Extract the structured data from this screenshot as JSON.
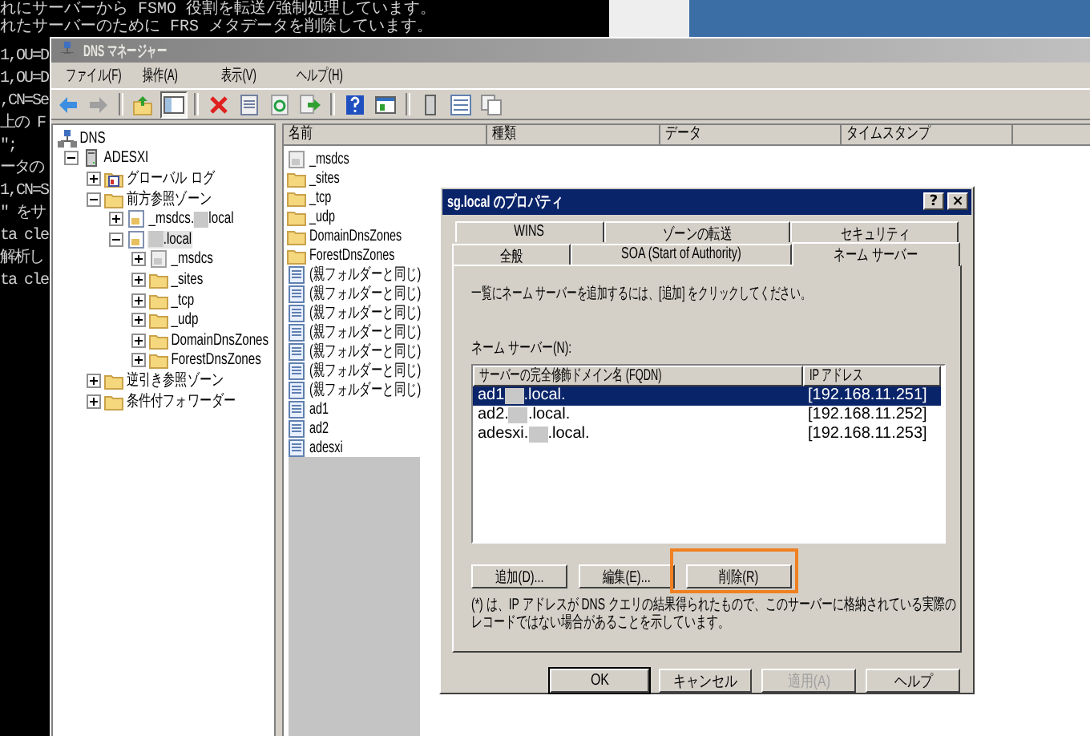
{
  "console": {
    "top_lines": [
      "れにサーバーから FSMO 役割を転送/強制処理しています。",
      "れたサーバーのために FRS メタデータを削除しています。"
    ],
    "side_lines": [
      "1,OU=D",
      "1,OU=D",
      ",CN=Se",
      "上の F",
      "\";",
      "ータの",
      "1,CN=S",
      "\" をサ",
      "ta cle",
      "解析し",
      "ta cle"
    ]
  },
  "window": {
    "title": "DNS マネージャー"
  },
  "menu": [
    "ファイル(F)",
    "操作(A)",
    "表示(V)",
    "ヘルプ(H)"
  ],
  "toolbar": [
    {
      "kind": "back",
      "pressed": false
    },
    {
      "kind": "forward",
      "pressed": false
    },
    {
      "kind": "sep"
    },
    {
      "kind": "up",
      "pressed": false
    },
    {
      "kind": "tree",
      "pressed": true
    },
    {
      "kind": "sep"
    },
    {
      "kind": "delete",
      "pressed": false
    },
    {
      "kind": "properties",
      "pressed": false
    },
    {
      "kind": "refresh",
      "pressed": false
    },
    {
      "kind": "export",
      "pressed": false
    },
    {
      "kind": "sep"
    },
    {
      "kind": "help",
      "pressed": false
    },
    {
      "kind": "console",
      "pressed": false
    },
    {
      "kind": "sep"
    },
    {
      "kind": "server",
      "pressed": false
    },
    {
      "kind": "list",
      "pressed": false
    },
    {
      "kind": "copy",
      "pressed": false
    }
  ],
  "tree": [
    {
      "kind": "dns",
      "parts": [
        {
          "kind": "text",
          "text": "DNS"
        }
      ],
      "children": [
        {
          "kind": "server",
          "expanded": true,
          "parts": [
            {
              "kind": "text",
              "text": "ADESXI"
            }
          ],
          "children": [
            {
              "kind": "log",
              "expanded": false,
              "parts": [
                {
                  "kind": "text",
                  "text": "グローバル ログ"
                }
              ]
            },
            {
              "kind": "folder",
              "expanded": true,
              "parts": [
                {
                  "kind": "text",
                  "text": "前方参照ゾーン"
                }
              ],
              "children": [
                {
                  "kind": "zone",
                  "expanded": false,
                  "parts": [
                    {
                      "kind": "text",
                      "text": "_msdcs."
                    },
                    {
                      "kind": "redaction"
                    },
                    {
                      "kind": "text",
                      "text": "local"
                    }
                  ]
                },
                {
                  "kind": "zone",
                  "expanded": true,
                  "selected": true,
                  "parts": [
                    {
                      "kind": "redaction"
                    },
                    {
                      "kind": "text",
                      "text": ".local"
                    }
                  ],
                  "children": [
                    {
                      "kind": "greyzone",
                      "expanded": false,
                      "parts": [
                        {
                          "kind": "text",
                          "text": "_msdcs"
                        }
                      ]
                    },
                    {
                      "kind": "folder",
                      "expanded": false,
                      "parts": [
                        {
                          "kind": "text",
                          "text": "_sites"
                        }
                      ]
                    },
                    {
                      "kind": "folder",
                      "expanded": false,
                      "parts": [
                        {
                          "kind": "text",
                          "text": "_tcp"
                        }
                      ]
                    },
                    {
                      "kind": "folder",
                      "expanded": false,
                      "parts": [
                        {
                          "kind": "text",
                          "text": "_udp"
                        }
                      ]
                    },
                    {
                      "kind": "folder",
                      "expanded": false,
                      "parts": [
                        {
                          "kind": "text",
                          "text": "DomainDnsZones"
                        }
                      ]
                    },
                    {
                      "kind": "folder",
                      "expanded": false,
                      "parts": [
                        {
                          "kind": "text",
                          "text": "ForestDnsZones"
                        }
                      ]
                    }
                  ]
                }
              ]
            },
            {
              "kind": "folder",
              "expanded": false,
              "parts": [
                {
                  "kind": "text",
                  "text": "逆引き参照ゾーン"
                }
              ]
            },
            {
              "kind": "folder",
              "expanded": false,
              "parts": [
                {
                  "kind": "text",
                  "text": "条件付フォワーダー"
                }
              ]
            }
          ]
        }
      ]
    }
  ],
  "list": {
    "columns": [
      "名前",
      "種類",
      "データ",
      "タイムスタンプ"
    ],
    "rows": [
      {
        "kind": "greyzone",
        "name": "_msdcs"
      },
      {
        "kind": "folder",
        "name": "_sites"
      },
      {
        "kind": "folder",
        "name": "_tcp"
      },
      {
        "kind": "folder",
        "name": "_udp"
      },
      {
        "kind": "folder",
        "name": "DomainDnsZones"
      },
      {
        "kind": "folder",
        "name": "ForestDnsZones"
      },
      {
        "kind": "record",
        "name": "(親フォルダーと同じ)"
      },
      {
        "kind": "record",
        "name": "(親フォルダーと同じ)"
      },
      {
        "kind": "record",
        "name": "(親フォルダーと同じ)"
      },
      {
        "kind": "record",
        "name": "(親フォルダーと同じ)"
      },
      {
        "kind": "record",
        "name": "(親フォルダーと同じ)"
      },
      {
        "kind": "record",
        "name": "(親フォルダーと同じ)"
      },
      {
        "kind": "record",
        "name": "(親フォルダーと同じ)"
      },
      {
        "kind": "record",
        "name": "ad1"
      },
      {
        "kind": "record",
        "name": "ad2"
      },
      {
        "kind": "record",
        "name": "adesxi"
      }
    ]
  },
  "dialog": {
    "title": "sg.local のプロパティ",
    "help_button": "?",
    "close_button": "×",
    "tab_rows": [
      [
        {
          "label": "WINS",
          "selected": false
        },
        {
          "label": "ゾーンの転送",
          "selected": false
        },
        {
          "label": "セキュリティ",
          "selected": false
        }
      ],
      [
        {
          "label": "全般",
          "selected": false
        },
        {
          "label": "SOA (Start of Authority)",
          "selected": false
        },
        {
          "label": "ネーム サーバー",
          "selected": true
        }
      ]
    ],
    "instruction": "一覧にネーム サーバーを追加するには、[追加] をクリックしてください。",
    "list_label": "ネーム サーバー(N):",
    "columns": [
      "サーバーの完全修飾ドメイン名 (FQDN)",
      "IP アドレス"
    ],
    "servers": [
      {
        "selected": true,
        "parts": [
          {
            "kind": "text",
            "text": "ad1"
          },
          {
            "kind": "redaction"
          },
          {
            "kind": "text",
            "text": ".local."
          }
        ],
        "ip": "[192.168.11.251]"
      },
      {
        "selected": false,
        "parts": [
          {
            "kind": "text",
            "text": "ad2."
          },
          {
            "kind": "redaction"
          },
          {
            "kind": "text",
            "text": ".local."
          }
        ],
        "ip": "[192.168.11.252]"
      },
      {
        "selected": false,
        "parts": [
          {
            "kind": "text",
            "text": "adesxi."
          },
          {
            "kind": "redaction"
          },
          {
            "kind": "text",
            "text": ".local."
          }
        ],
        "ip": "[192.168.11.253]"
      }
    ],
    "actions": [
      {
        "label": "追加(D)...",
        "highlighted": false
      },
      {
        "label": "編集(E)...",
        "highlighted": false
      },
      {
        "label": "削除(R)",
        "highlighted": true
      }
    ],
    "note": "(*) は、IP アドレスが DNS クエリの結果得られたもので、このサーバーに格納されている実際のレコードではない場合があることを示しています。",
    "buttons": [
      {
        "label": "OK",
        "default": true,
        "disabled": false
      },
      {
        "label": "キャンセル",
        "default": false,
        "disabled": false
      },
      {
        "label": "適用(A)",
        "default": false,
        "disabled": true
      },
      {
        "label": "ヘルプ",
        "default": false,
        "disabled": false
      }
    ]
  }
}
